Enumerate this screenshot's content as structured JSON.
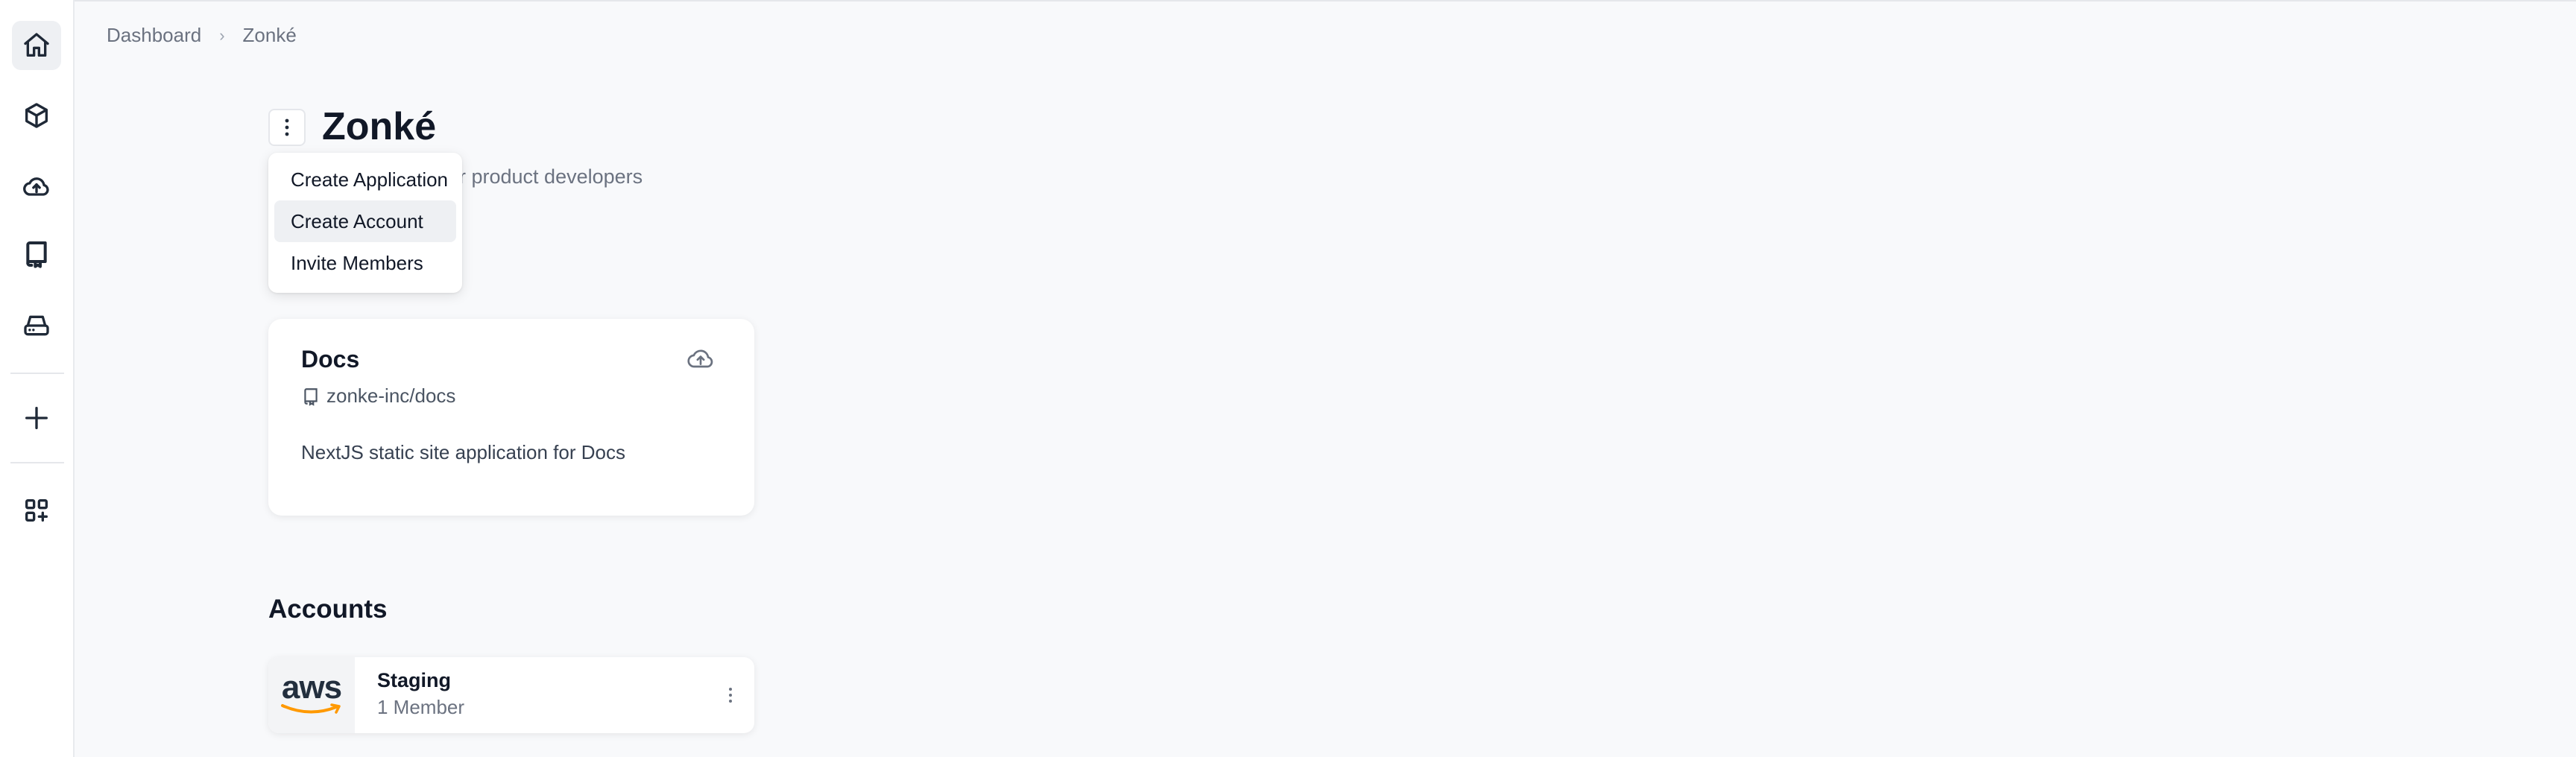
{
  "breadcrumb": {
    "root": "Dashboard",
    "current": "Zonké"
  },
  "header": {
    "title": "Zonké",
    "subtitle": "r product developers"
  },
  "dropdown": {
    "items": [
      {
        "label": "Create Application"
      },
      {
        "label": "Create Account"
      },
      {
        "label": "Invite Members"
      }
    ]
  },
  "application": {
    "title": "Docs",
    "repo": "zonke-inc/docs",
    "description": "NextJS static site application for Docs"
  },
  "accounts": {
    "heading": "Accounts",
    "items": [
      {
        "provider_logo_text": "aws",
        "name": "Staging",
        "members": "1 Member"
      }
    ]
  },
  "sidebar": {
    "icons": [
      "home-icon",
      "box-icon",
      "cloud-upload-icon",
      "repository-icon",
      "database-icon",
      "plus-icon",
      "apps-add-icon"
    ],
    "active": "home-icon"
  },
  "colors": {
    "aws_orange": "#ff9900",
    "aws_dark": "#232f3e",
    "background": "#f8f9fb"
  }
}
